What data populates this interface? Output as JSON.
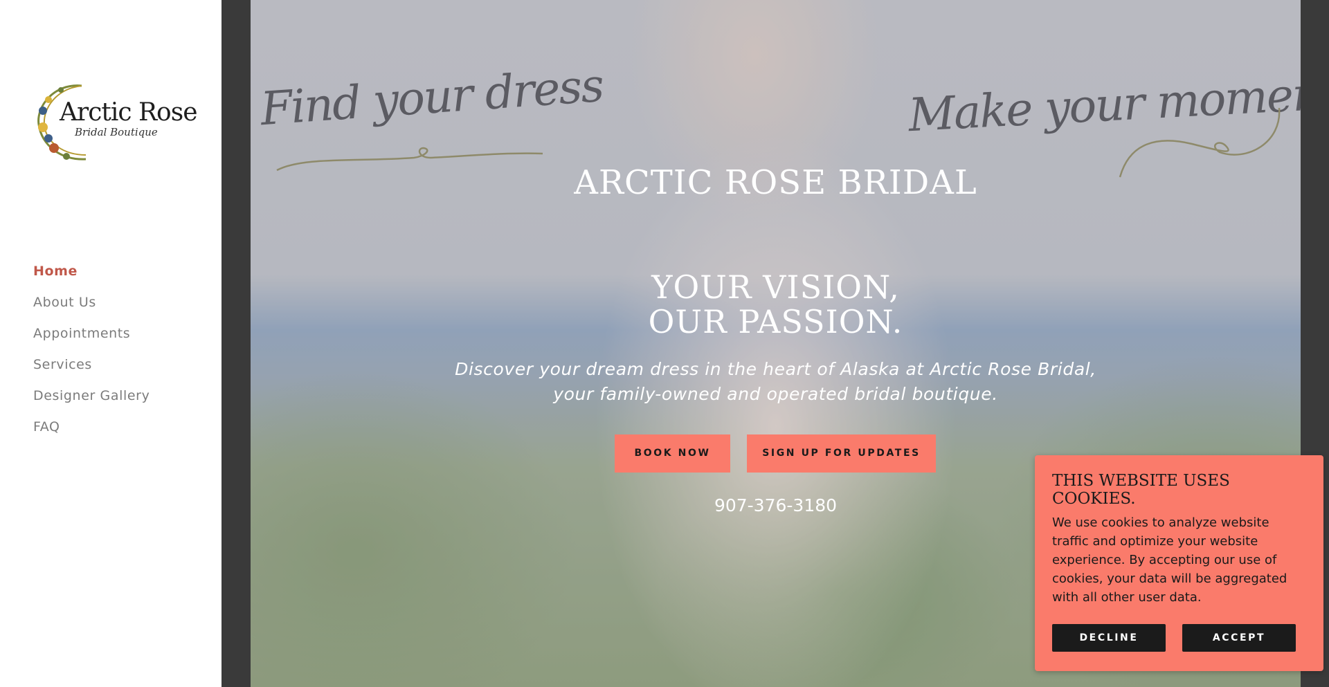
{
  "sidebar": {
    "logo": {
      "title": "Arctic Rose",
      "subtitle": "Bridal Boutique"
    },
    "nav": [
      {
        "label": "Home",
        "active": true
      },
      {
        "label": "About Us"
      },
      {
        "label": "Appointments"
      },
      {
        "label": "Services"
      },
      {
        "label": "Designer Gallery"
      },
      {
        "label": "FAQ"
      }
    ]
  },
  "hero": {
    "script_left": "Find your dress",
    "script_right": "Make your moment",
    "brand": "ARCTIC ROSE BRIDAL",
    "headline_line1": "YOUR VISION,",
    "headline_line2": "OUR PASSION.",
    "subtitle_line1": "Discover your dream dress in the heart of Alaska at Arctic Rose Bridal,",
    "subtitle_line2": "your family-owned and operated bridal boutique.",
    "buttons": {
      "book": "BOOK NOW",
      "signup": "SIGN UP FOR UPDATES"
    },
    "phone": "907-376-3180"
  },
  "cookie": {
    "title": "THIS WEBSITE USES COOKIES.",
    "text": "We use cookies to analyze website traffic and optimize your website experience. By accepting our use of cookies, your data will be aggregated with all other user data.",
    "decline": "DECLINE",
    "accept": "ACCEPT"
  },
  "colors": {
    "accent": "#fa7b6b",
    "nav_active": "#c0584a",
    "nav_text": "#7b7b7b",
    "dark_button": "#1b1b1b"
  }
}
